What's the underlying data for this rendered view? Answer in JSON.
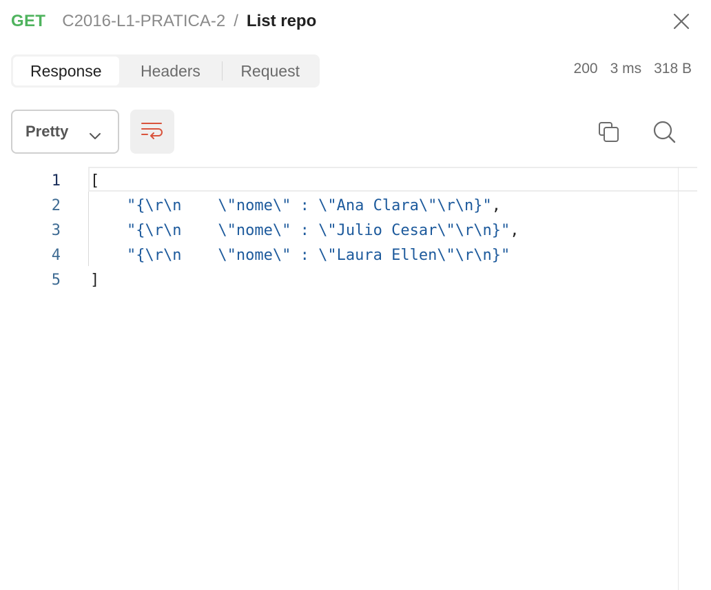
{
  "header": {
    "method": "GET",
    "collection": "C2016-L1-PRATICA-2",
    "separator": "/",
    "request_name": "List repo",
    "close_icon": "close-icon"
  },
  "tabs": [
    {
      "label": "Response",
      "active": true
    },
    {
      "label": "Headers",
      "active": false
    },
    {
      "label": "Request",
      "active": false
    }
  ],
  "stats": {
    "status": "200",
    "time": "3 ms",
    "size": "318 B"
  },
  "toolbar": {
    "format_selected": "Pretty",
    "wrap_icon": "wrap-lines-icon",
    "copy_icon": "copy-icon",
    "search_icon": "search-icon"
  },
  "editor": {
    "line_numbers": [
      "1",
      "2",
      "3",
      "4",
      "5"
    ],
    "lines": [
      {
        "text": "[",
        "type": "punct"
      },
      {
        "text": "    \"{\\r\\n    \\\"nome\\\" : \\\"Ana Clara\\\"\\r\\n}\"",
        "suffix": ",",
        "type": "str"
      },
      {
        "text": "    \"{\\r\\n    \\\"nome\\\" : \\\"Julio Cesar\\\"\\r\\n}\"",
        "suffix": ",",
        "type": "str"
      },
      {
        "text": "    \"{\\r\\n    \\\"nome\\\" : \\\"Laura Ellen\\\"\\r\\n}\"",
        "suffix": "",
        "type": "str"
      },
      {
        "text": "]",
        "type": "punct"
      }
    ]
  },
  "colors": {
    "method_get": "#4fb35e",
    "string": "#1d5a9c",
    "wrap_icon": "#d9533c"
  }
}
